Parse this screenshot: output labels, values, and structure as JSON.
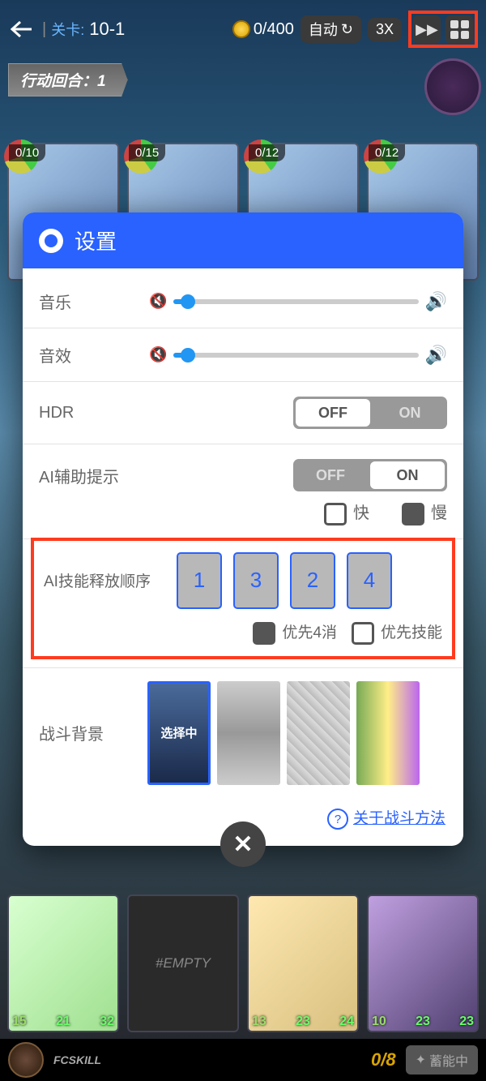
{
  "topbar": {
    "stage_prefix": "关卡:",
    "stage": "10-1",
    "coin": "0/400",
    "auto": "自动",
    "speed": "3X"
  },
  "turn_badge": "行动回合：1",
  "enemies": [
    {
      "hp": "0/10"
    },
    {
      "hp": "0/15"
    },
    {
      "hp": "0/12"
    },
    {
      "hp": "0/12"
    }
  ],
  "party": {
    "empty": "#EMPTY",
    "stats": [
      [
        "15",
        "21",
        "32"
      ],
      [
        "",
        "",
        ""
      ],
      [
        "13",
        "23",
        "24"
      ],
      [
        "10",
        "23",
        "23"
      ]
    ]
  },
  "bottom": {
    "fc": "FCSKILL",
    "count": "0/8",
    "charge": "蓄能中"
  },
  "settings": {
    "title": "设置",
    "music": "音乐",
    "sfx": "音效",
    "hdr": {
      "label": "HDR",
      "off": "OFF",
      "on": "ON",
      "value": "OFF"
    },
    "ai_hint": {
      "label": "AI辅助提示",
      "off": "OFF",
      "on": "ON",
      "value": "ON",
      "fast": "快",
      "slow": "慢"
    },
    "ai_order": {
      "label": "AI技能释放顺序",
      "order": [
        "1",
        "3",
        "2",
        "4"
      ],
      "prio4": "优先4消",
      "prioSkill": "优先技能"
    },
    "bg": {
      "label": "战斗背景",
      "selected": "选择中"
    },
    "about": "关于战斗方法"
  }
}
